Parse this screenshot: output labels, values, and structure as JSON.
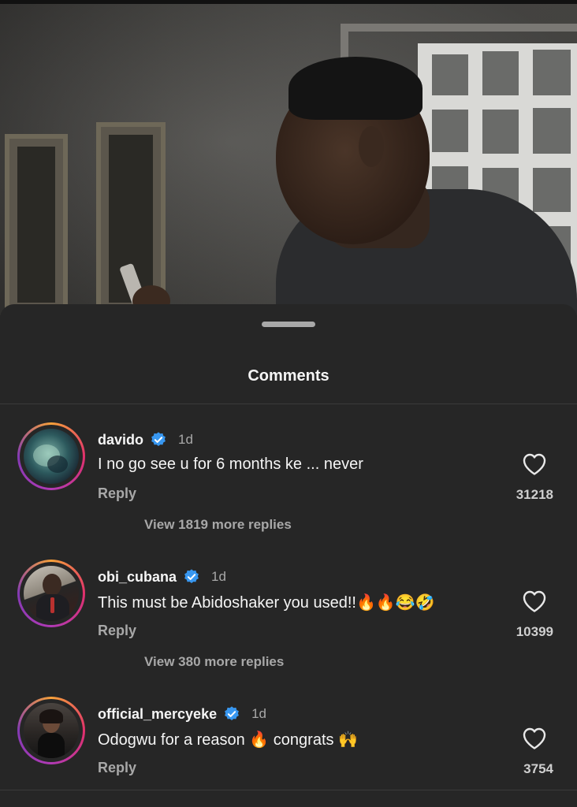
{
  "sheet": {
    "title": "Comments"
  },
  "colors": {
    "background": "#262626",
    "verified": "#3897f0",
    "secondary_text": "#a8a8a8"
  },
  "comments": [
    {
      "username": "davido",
      "verified": true,
      "time": "1d",
      "text": "I no go see  u for 6 months ke ... never",
      "reply_label": "Reply",
      "likes": "31218",
      "view_replies": "View 1819 more replies"
    },
    {
      "username": "obi_cubana",
      "verified": true,
      "time": "1d",
      "text": "This must be Abidoshaker  you used!!🔥🔥😂🤣",
      "reply_label": "Reply",
      "likes": "10399",
      "view_replies": "View 380 more replies"
    },
    {
      "username": "official_mercyeke",
      "verified": true,
      "time": "1d",
      "text": "Odogwu for a reason 🔥 congrats 🙌",
      "reply_label": "Reply",
      "likes": "3754"
    }
  ],
  "icons": {
    "verified": "verified-badge-icon",
    "like": "heart-outline-icon"
  }
}
